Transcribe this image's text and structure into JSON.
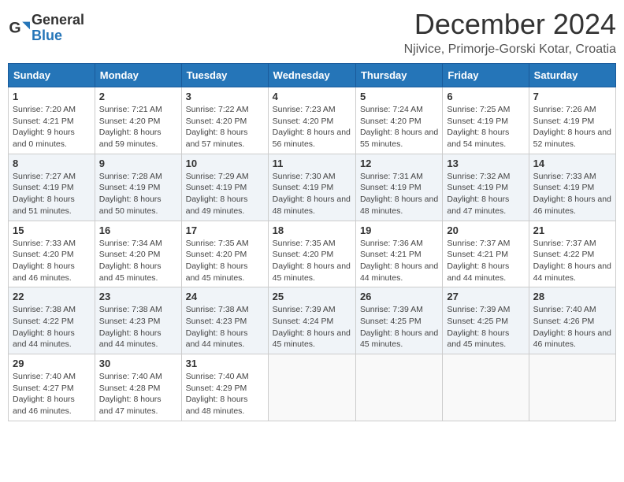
{
  "header": {
    "logo_general": "General",
    "logo_blue": "Blue",
    "month_title": "December 2024",
    "location": "Njivice, Primorje-Gorski Kotar, Croatia"
  },
  "weekdays": [
    "Sunday",
    "Monday",
    "Tuesday",
    "Wednesday",
    "Thursday",
    "Friday",
    "Saturday"
  ],
  "weeks": [
    [
      {
        "day": "1",
        "sunrise": "7:20 AM",
        "sunset": "4:21 PM",
        "daylight": "9 hours and 0 minutes"
      },
      {
        "day": "2",
        "sunrise": "7:21 AM",
        "sunset": "4:20 PM",
        "daylight": "8 hours and 59 minutes"
      },
      {
        "day": "3",
        "sunrise": "7:22 AM",
        "sunset": "4:20 PM",
        "daylight": "8 hours and 57 minutes"
      },
      {
        "day": "4",
        "sunrise": "7:23 AM",
        "sunset": "4:20 PM",
        "daylight": "8 hours and 56 minutes"
      },
      {
        "day": "5",
        "sunrise": "7:24 AM",
        "sunset": "4:20 PM",
        "daylight": "8 hours and 55 minutes"
      },
      {
        "day": "6",
        "sunrise": "7:25 AM",
        "sunset": "4:19 PM",
        "daylight": "8 hours and 54 minutes"
      },
      {
        "day": "7",
        "sunrise": "7:26 AM",
        "sunset": "4:19 PM",
        "daylight": "8 hours and 52 minutes"
      }
    ],
    [
      {
        "day": "8",
        "sunrise": "7:27 AM",
        "sunset": "4:19 PM",
        "daylight": "8 hours and 51 minutes"
      },
      {
        "day": "9",
        "sunrise": "7:28 AM",
        "sunset": "4:19 PM",
        "daylight": "8 hours and 50 minutes"
      },
      {
        "day": "10",
        "sunrise": "7:29 AM",
        "sunset": "4:19 PM",
        "daylight": "8 hours and 49 minutes"
      },
      {
        "day": "11",
        "sunrise": "7:30 AM",
        "sunset": "4:19 PM",
        "daylight": "8 hours and 48 minutes"
      },
      {
        "day": "12",
        "sunrise": "7:31 AM",
        "sunset": "4:19 PM",
        "daylight": "8 hours and 48 minutes"
      },
      {
        "day": "13",
        "sunrise": "7:32 AM",
        "sunset": "4:19 PM",
        "daylight": "8 hours and 47 minutes"
      },
      {
        "day": "14",
        "sunrise": "7:33 AM",
        "sunset": "4:19 PM",
        "daylight": "8 hours and 46 minutes"
      }
    ],
    [
      {
        "day": "15",
        "sunrise": "7:33 AM",
        "sunset": "4:20 PM",
        "daylight": "8 hours and 46 minutes"
      },
      {
        "day": "16",
        "sunrise": "7:34 AM",
        "sunset": "4:20 PM",
        "daylight": "8 hours and 45 minutes"
      },
      {
        "day": "17",
        "sunrise": "7:35 AM",
        "sunset": "4:20 PM",
        "daylight": "8 hours and 45 minutes"
      },
      {
        "day": "18",
        "sunrise": "7:35 AM",
        "sunset": "4:20 PM",
        "daylight": "8 hours and 45 minutes"
      },
      {
        "day": "19",
        "sunrise": "7:36 AM",
        "sunset": "4:21 PM",
        "daylight": "8 hours and 44 minutes"
      },
      {
        "day": "20",
        "sunrise": "7:37 AM",
        "sunset": "4:21 PM",
        "daylight": "8 hours and 44 minutes"
      },
      {
        "day": "21",
        "sunrise": "7:37 AM",
        "sunset": "4:22 PM",
        "daylight": "8 hours and 44 minutes"
      }
    ],
    [
      {
        "day": "22",
        "sunrise": "7:38 AM",
        "sunset": "4:22 PM",
        "daylight": "8 hours and 44 minutes"
      },
      {
        "day": "23",
        "sunrise": "7:38 AM",
        "sunset": "4:23 PM",
        "daylight": "8 hours and 44 minutes"
      },
      {
        "day": "24",
        "sunrise": "7:38 AM",
        "sunset": "4:23 PM",
        "daylight": "8 hours and 44 minutes"
      },
      {
        "day": "25",
        "sunrise": "7:39 AM",
        "sunset": "4:24 PM",
        "daylight": "8 hours and 45 minutes"
      },
      {
        "day": "26",
        "sunrise": "7:39 AM",
        "sunset": "4:25 PM",
        "daylight": "8 hours and 45 minutes"
      },
      {
        "day": "27",
        "sunrise": "7:39 AM",
        "sunset": "4:25 PM",
        "daylight": "8 hours and 45 minutes"
      },
      {
        "day": "28",
        "sunrise": "7:40 AM",
        "sunset": "4:26 PM",
        "daylight": "8 hours and 46 minutes"
      }
    ],
    [
      {
        "day": "29",
        "sunrise": "7:40 AM",
        "sunset": "4:27 PM",
        "daylight": "8 hours and 46 minutes"
      },
      {
        "day": "30",
        "sunrise": "7:40 AM",
        "sunset": "4:28 PM",
        "daylight": "8 hours and 47 minutes"
      },
      {
        "day": "31",
        "sunrise": "7:40 AM",
        "sunset": "4:29 PM",
        "daylight": "8 hours and 48 minutes"
      },
      null,
      null,
      null,
      null
    ]
  ]
}
